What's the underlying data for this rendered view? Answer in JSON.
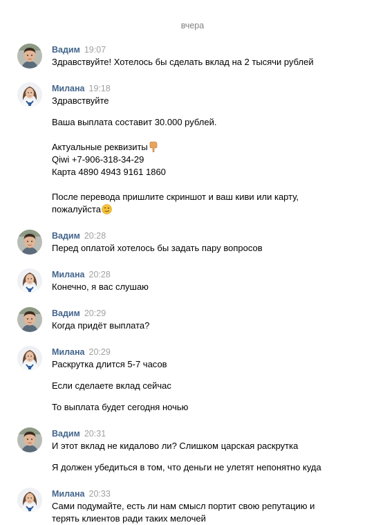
{
  "date_separator": "вчера",
  "messages": [
    {
      "author": "Вадим",
      "time": "19:07",
      "avatar": "vadim-avatar-photo",
      "lines": [
        "Здравствуйте! Хотелось бы сделать вклад на 2 тысячи рублей"
      ]
    },
    {
      "author": "Милана",
      "time": "19:18",
      "avatar": "milana-avatar-photo",
      "lines": [
        "Здравствуйте",
        "Ваша выплата составит 30.000 рублей.",
        "Актуальные реквизиты",
        "Qiwi +7-906-318-34-29",
        "Карта 4890 4943 9161 1860",
        "После перевода пришлите скриншот и ваш киви или карту,",
        "пожалуйста"
      ],
      "emojis": [
        "pointing-down-emoji",
        "winking-face-emoji"
      ]
    },
    {
      "author": "Вадим",
      "time": "20:28",
      "lines": [
        "Перед оплатой хотелось бы задать пару вопросов"
      ]
    },
    {
      "author": "Милана",
      "time": "20:28",
      "lines": [
        "Конечно, я вас слушаю"
      ]
    },
    {
      "author": "Вадим",
      "time": "20:29",
      "lines": [
        "Когда придёт выплата?"
      ]
    },
    {
      "author": "Милана",
      "time": "20:29",
      "lines": [
        "Раскрутка длится 5-7 часов",
        "Если сделаете вклад сейчас",
        "То выплата будет сегодня ночью"
      ]
    },
    {
      "author": "Вадим",
      "time": "20:31",
      "lines": [
        "И этот вклад не кидалово ли? Слишком царская раскрутка",
        "Я должен убедиться в том, что деньги не улетят непонятно куда"
      ]
    },
    {
      "author": "Милана",
      "time": "20:33",
      "lines": [
        "Сами подумайте, есть ли нам смысл портит свою репутацию и",
        "терять клиентов ради таких мелочей"
      ]
    }
  ],
  "colors": {
    "author_name": "#42648b",
    "timestamp": "#a0a0a0",
    "text": "#000000",
    "date_separator": "#828282"
  }
}
